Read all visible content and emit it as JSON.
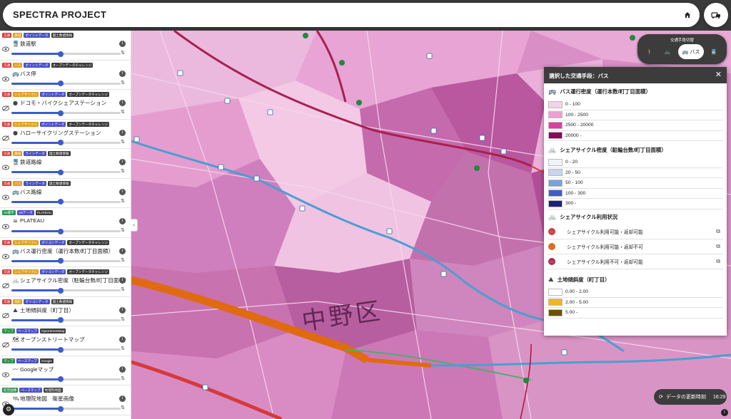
{
  "app": {
    "title": "SPECTRA PROJECT"
  },
  "header": {
    "home_icon": "home-icon",
    "mode_icon": "car-bus-icon"
  },
  "sidebar": {
    "layers": [
      {
        "tags": [
          [
            "交通",
            "#d63b3b"
          ],
          [
            "鉄道",
            "#e0a020"
          ],
          [
            "ポイントデータ",
            "#4a4fc9"
          ],
          [
            "国土数値情報",
            "#3c3c3c"
          ]
        ],
        "icon": "train-icon",
        "glyph": "🚆",
        "label": "鉄道駅",
        "visible": true,
        "opacity": 0.45
      },
      {
        "tags": [
          [
            "交通",
            "#d63b3b"
          ],
          [
            "バス",
            "#e0a020"
          ],
          [
            "ポイントデータ",
            "#4a4fc9"
          ],
          [
            "オープンデータチャレンジ",
            "#3c3c3c"
          ]
        ],
        "icon": "bus-icon",
        "glyph": "🚌",
        "label": "バス停",
        "visible": true,
        "opacity": 0.45
      },
      {
        "tags": [
          [
            "交通",
            "#d63b3b"
          ],
          [
            "シェアサイクル",
            "#e0a020"
          ],
          [
            "ポイントデータ",
            "#4a4fc9"
          ],
          [
            "オープンデータチャレンジ",
            "#3c3c3c"
          ]
        ],
        "icon": "docomo-bike-icon",
        "glyph": "●",
        "label": "ドコモ・バイクシェアステーション",
        "visible": false,
        "opacity": 0.45
      },
      {
        "tags": [
          [
            "交通",
            "#d63b3b"
          ],
          [
            "シェアサイクル",
            "#e0a020"
          ],
          [
            "ポイントデータ",
            "#4a4fc9"
          ],
          [
            "オープンデータチャレンジ",
            "#3c3c3c"
          ]
        ],
        "icon": "hello-cycling-icon",
        "glyph": "●",
        "label": "ハローサイクリングステーション",
        "visible": false,
        "opacity": 0.45
      },
      {
        "tags": [
          [
            "交通",
            "#d63b3b"
          ],
          [
            "鉄道",
            "#e0a020"
          ],
          [
            "ラインデータ",
            "#4a4fc9"
          ],
          [
            "国土数値情報",
            "#3c3c3c"
          ]
        ],
        "icon": "train-icon",
        "glyph": "🚆",
        "label": "鉄道路線",
        "visible": true,
        "opacity": 0.45
      },
      {
        "tags": [
          [
            "交通",
            "#d63b3b"
          ],
          [
            "バス",
            "#e0a020"
          ],
          [
            "ラインデータ",
            "#4a4fc9"
          ],
          [
            "国土数値情報",
            "#3c3c3c"
          ]
        ],
        "icon": "bus-icon",
        "glyph": "🚌",
        "label": "バス路線",
        "visible": true,
        "opacity": 0.45
      },
      {
        "tags": [
          [
            "3D都市",
            "#2a8f4a"
          ],
          [
            "3Dデータ",
            "#4a4fc9"
          ],
          [
            "PLATEAU",
            "#3c3c3c"
          ]
        ],
        "icon": "plateau-icon",
        "glyph": "≋",
        "label": "PLATEAU",
        "visible": true,
        "opacity": 0.45
      },
      {
        "tags": [
          [
            "交通",
            "#d63b3b"
          ],
          [
            "シェアサイクル",
            "#e0a020"
          ],
          [
            "ポリゴンデータ",
            "#4a4fc9"
          ],
          [
            "オープンデータチャレンジ",
            "#3c3c3c"
          ]
        ],
        "icon": "bus-icon",
        "glyph": "🚌",
        "label": "バス運行密度（運行本数/町丁目面積）",
        "visible": true,
        "opacity": 0.45
      },
      {
        "tags": [
          [
            "交通",
            "#d63b3b"
          ],
          [
            "シェアサイクル",
            "#e0a020"
          ],
          [
            "ポリゴンデータ",
            "#4a4fc9"
          ],
          [
            "オープンデータチャレンジ",
            "#3c3c3c"
          ]
        ],
        "icon": "bicycle-icon",
        "glyph": "🚲",
        "label": "シェアサイクル密度（駐輪台数/町丁目面積）",
        "visible": false,
        "opacity": 0.45
      },
      {
        "tags": [
          [
            "交通",
            "#d63b3b"
          ],
          [
            "地形",
            "#e0a020"
          ],
          [
            "ポリゴンデータ",
            "#4a4fc9"
          ],
          [
            "国土数値情報",
            "#3c3c3c"
          ]
        ],
        "icon": "slope-icon",
        "glyph": "⛰",
        "label": "土地傾斜度（町丁目）",
        "visible": false,
        "opacity": 0.45
      },
      {
        "tags": [
          [
            "マップ",
            "#2a8f4a"
          ],
          [
            "ベースマップ",
            "#4a4fc9"
          ],
          [
            "OpenStreetMap",
            "#3c3c3c"
          ]
        ],
        "icon": "map-icon",
        "glyph": "🗺",
        "label": "オープンストリートマップ",
        "visible": false,
        "opacity": 0.45
      },
      {
        "tags": [
          [
            "マップ",
            "#2a8f4a"
          ],
          [
            "ベースマップ",
            "#4a4fc9"
          ],
          [
            "Google",
            "#3c3c3c"
          ]
        ],
        "icon": "google-icon",
        "glyph": "〰",
        "label": "Googleマップ",
        "visible": true,
        "opacity": 0.45
      },
      {
        "tags": [
          [
            "航空画像",
            "#2a8f4a"
          ],
          [
            "ベースマップ",
            "#4a4fc9"
          ],
          [
            "地理院地図",
            "#3c3c3c"
          ]
        ],
        "icon": "satellite-icon",
        "glyph": "🛰",
        "label": "地理院地図　衛星画像",
        "visible": true,
        "opacity": 0.45
      }
    ]
  },
  "mode_switch": {
    "title": "交通手段切替",
    "modes": [
      {
        "name": "walk",
        "icon": "walk-icon",
        "glyph": "🚶",
        "label": ""
      },
      {
        "name": "bicycle",
        "icon": "bicycle-icon",
        "glyph": "🚲",
        "label": ""
      },
      {
        "name": "bus",
        "icon": "bus-icon",
        "glyph": "🚌",
        "label": "バス",
        "active": true
      },
      {
        "name": "train",
        "icon": "train-icon",
        "glyph": "🚆",
        "label": ""
      }
    ]
  },
  "legend": {
    "title": "選択した交通手段：バス",
    "sections": {
      "bus_density": {
        "title": "バス運行密度（運行本数/町丁目面積）",
        "icon": "bus-icon",
        "rows": [
          {
            "label": "0 - 100",
            "color": "#f6d2ea"
          },
          {
            "label": "100 - 2500",
            "color": "#ee9fd3"
          },
          {
            "label": "2500 - 20000",
            "color": "#d9409f"
          },
          {
            "label": "20000 -",
            "color": "#8a0a55"
          }
        ]
      },
      "cycle_density": {
        "title": "シェアサイクル密度（駐輪台数/町丁目面積）",
        "icon": "bicycle-icon",
        "rows": [
          {
            "label": "0 - 20",
            "color": "#f2f4fb"
          },
          {
            "label": "20 - 50",
            "color": "#c8d3ee"
          },
          {
            "label": "50 - 100",
            "color": "#7a9fdc"
          },
          {
            "label": "100 - 300",
            "color": "#3f5ec7"
          },
          {
            "label": "300 -",
            "color": "#1d2277"
          }
        ]
      },
      "cycle_usage": {
        "title": "シェアサイクル利用状況",
        "icon": "bicycle-icon",
        "rows": [
          {
            "label": "シェアサイクル利用可能・返却可能",
            "color": "#d63b3b"
          },
          {
            "label": "シェアサイクル利用可能・返却不可",
            "color": "#e06b1f"
          },
          {
            "label": "シェアサイクル利用不可・返却可能",
            "color": "#b52a4a"
          }
        ]
      },
      "slope": {
        "title": "土地傾斜度（町丁目）",
        "icon": "slope-icon",
        "rows": [
          {
            "label": "0.00 - 2.00",
            "color": "#ffffff"
          },
          {
            "label": "2.00 - 5.00",
            "color": "#f0b429"
          },
          {
            "label": "5.00 -",
            "color": "#6b5200"
          }
        ]
      }
    }
  },
  "map": {
    "area_label": "中野区",
    "colors": {
      "bus_line_blue": "#4a9fd0",
      "rail_orange": "#e06a10",
      "rail_red": "#d63a3a",
      "rail_maroon": "#a8204f"
    }
  },
  "update": {
    "label": "データの更新時刻",
    "time": "16:29"
  }
}
